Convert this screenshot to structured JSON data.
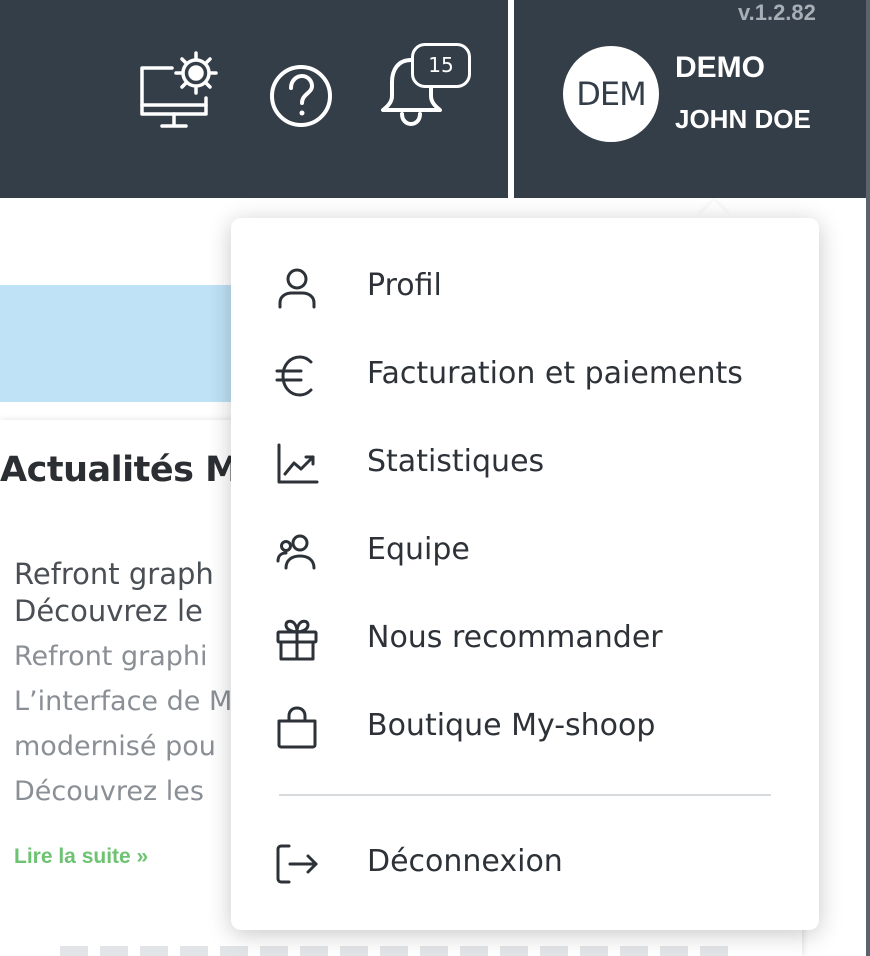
{
  "header": {
    "version": "v.1.2.82",
    "notifications_count": "15",
    "avatar_initials": "DEM",
    "company_name": "DEMO",
    "user_name": "JOHN DOE",
    "background_color": "#343e48",
    "icons": [
      "computer-settings-icon",
      "help-icon",
      "bell-icon"
    ]
  },
  "news": {
    "title": "Actualités M",
    "article_title_lines": [
      "Refront graph",
      "Découvrez le"
    ],
    "article_body_lines": [
      "Refront graphi",
      "L’interface de M",
      "modernisé pou",
      "Découvrez les"
    ],
    "read_more": "Lire la suite »",
    "read_more_color": "#6dc372"
  },
  "user_menu": {
    "items": [
      {
        "label": "Profil",
        "icon": "user-icon"
      },
      {
        "label": "Facturation et paiements",
        "icon": "euro-icon"
      },
      {
        "label": "Statistiques",
        "icon": "chart-icon"
      },
      {
        "label": "Equipe",
        "icon": "team-icon"
      },
      {
        "label": "Nous recommander",
        "icon": "gift-icon"
      },
      {
        "label": "Boutique My-shoop",
        "icon": "shopping-bag-icon"
      }
    ],
    "logout": {
      "label": "Déconnexion",
      "icon": "logout-icon"
    }
  }
}
